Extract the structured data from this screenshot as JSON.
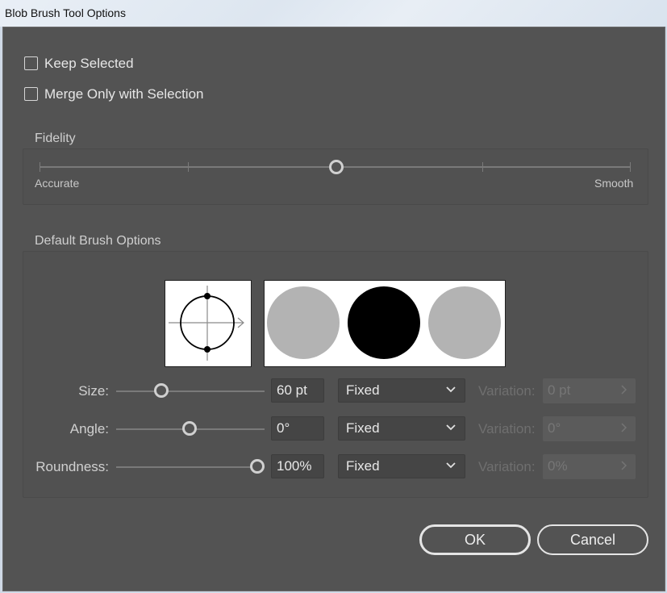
{
  "window": {
    "title": "Blob Brush Tool Options"
  },
  "options": {
    "keep_selected": {
      "label": "Keep Selected",
      "checked": false
    },
    "merge_only": {
      "label": "Merge Only with Selection",
      "checked": false
    }
  },
  "fidelity": {
    "title": "Fidelity",
    "min_label": "Accurate",
    "max_label": "Smooth",
    "value_fraction": 0.5
  },
  "brush": {
    "title": "Default Brush Options",
    "rows": [
      {
        "label": "Size:",
        "value": "60 pt",
        "mode": "Fixed",
        "variation_label": "Variation:",
        "variation_value": "0 pt",
        "slider_fraction": 0.31
      },
      {
        "label": "Angle:",
        "value": "0°",
        "mode": "Fixed",
        "variation_label": "Variation:",
        "variation_value": "0°",
        "slider_fraction": 0.5
      },
      {
        "label": "Roundness:",
        "value": "100%",
        "mode": "Fixed",
        "variation_label": "Variation:",
        "variation_value": "0%",
        "slider_fraction": 1.0
      }
    ]
  },
  "buttons": {
    "ok": "OK",
    "cancel": "Cancel"
  },
  "icons": {
    "dropdown": "chevron-down-icon",
    "variation_arrow": "chevron-right-icon"
  }
}
